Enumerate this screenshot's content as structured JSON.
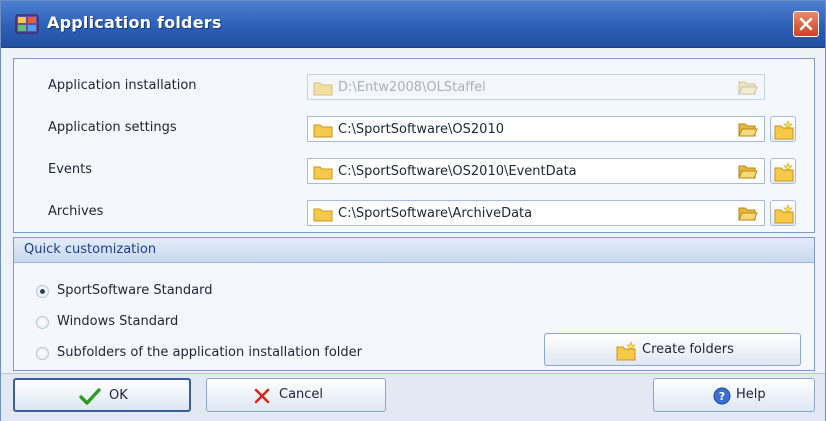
{
  "window": {
    "title": "Application folders",
    "close_icon": "close-icon"
  },
  "folders": [
    {
      "label": "Application installation",
      "path": "D:\\Entw2008\\OLStaffel",
      "enabled": false
    },
    {
      "label": "Application settings",
      "path": "C:\\SportSoftware\\OS2010",
      "enabled": true
    },
    {
      "label": "Events",
      "path": "C:\\SportSoftware\\OS2010\\EventData",
      "enabled": true
    },
    {
      "label": "Archives",
      "path": "C:\\SportSoftware\\ArchiveData",
      "enabled": true
    }
  ],
  "quick": {
    "header": "Quick customization",
    "options": [
      {
        "label": "SportSoftware Standard",
        "checked": true
      },
      {
        "label": "Windows Standard",
        "checked": false
      },
      {
        "label": "Subfolders of the application installation folder",
        "checked": false
      }
    ],
    "create_label": "Create folders"
  },
  "footer": {
    "ok_label": "OK",
    "cancel_label": "Cancel",
    "help_label": "Help"
  },
  "colors": {
    "titlebar": "#2c5fb8",
    "close": "#d0431f",
    "accent_text": "#1b3f8f"
  }
}
